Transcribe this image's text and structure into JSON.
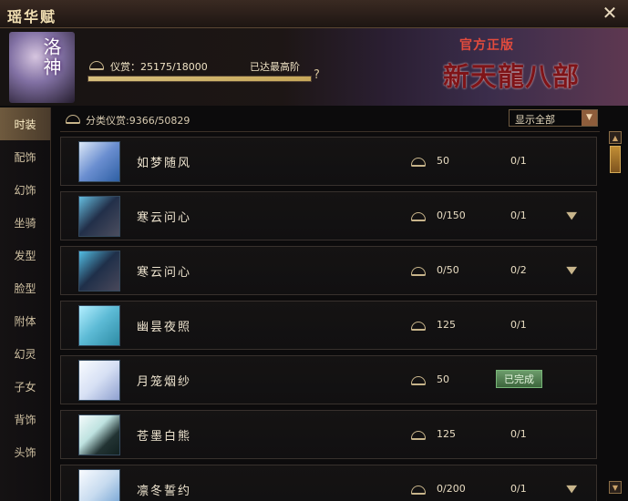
{
  "window": {
    "title": "瑶华赋",
    "close_icon": "close-icon"
  },
  "banner": {
    "portrait_name": "洛神",
    "reward_label": "仪赏：25175/18000",
    "max_label": "已达最高阶",
    "help": "?",
    "progress_fraction": 1,
    "ad_tag": "官方正版",
    "ad_title": "新天龍八部"
  },
  "sidebar": {
    "items": [
      {
        "label": "时装",
        "active": true
      },
      {
        "label": "配饰"
      },
      {
        "label": "幻饰"
      },
      {
        "label": "坐骑"
      },
      {
        "label": "发型"
      },
      {
        "label": "脸型"
      },
      {
        "label": "附体"
      },
      {
        "label": "幻灵"
      },
      {
        "label": "子女"
      },
      {
        "label": "背饰"
      },
      {
        "label": "头饰"
      }
    ]
  },
  "filter": {
    "label": "分类仪赏:9366/50829",
    "dropdown_value": "显示全部",
    "dropdown_icon": "chevron-down-icon"
  },
  "items": [
    {
      "name": "如梦随风",
      "reward": "50",
      "count": "0/1",
      "expand": "",
      "badge": ""
    },
    {
      "name": "寒云问心",
      "reward": "0/150",
      "count": "0/1",
      "expand": "▼",
      "badge": ""
    },
    {
      "name": "寒云问心",
      "reward": "0/50",
      "count": "0/2",
      "expand": "▼",
      "badge": ""
    },
    {
      "name": "幽昙夜照",
      "reward": "125",
      "count": "0/1",
      "expand": "",
      "badge": ""
    },
    {
      "name": "月笼烟纱",
      "reward": "50",
      "count": "",
      "expand": "",
      "badge": "已完成"
    },
    {
      "name": "苍墨白熊",
      "reward": "125",
      "count": "0/1",
      "expand": "",
      "badge": ""
    },
    {
      "name": "凛冬誓约",
      "reward": "0/200",
      "count": "0/1",
      "expand": "▼",
      "badge": ""
    }
  ],
  "scrollbar": {
    "up_icon": "chevron-up-icon",
    "down_icon": "chevron-down-icon"
  }
}
